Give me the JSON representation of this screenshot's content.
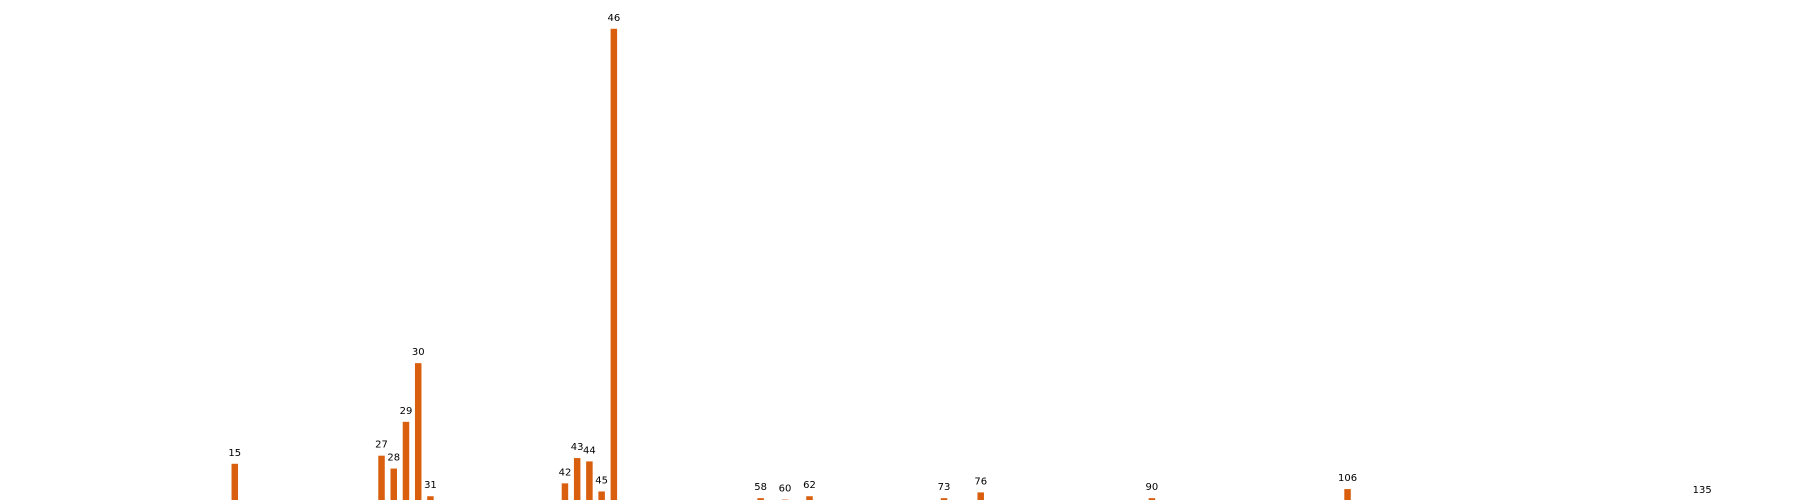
{
  "chart_data": {
    "type": "bar",
    "title": "",
    "xlabel": "",
    "ylabel": "",
    "grid": false,
    "legend": "none",
    "color": "#d95f0e",
    "show_axes": false,
    "xlim": [
      -4.2,
      143
    ],
    "ylim": [
      0,
      100
    ],
    "points": [
      {
        "x": 15,
        "y": 7.8
      },
      {
        "x": 27,
        "y": 9.5
      },
      {
        "x": 28,
        "y": 6.8
      },
      {
        "x": 29,
        "y": 16.6
      },
      {
        "x": 30,
        "y": 28.9
      },
      {
        "x": 31,
        "y": 1.0
      },
      {
        "x": 42,
        "y": 3.7
      },
      {
        "x": 43,
        "y": 9.0
      },
      {
        "x": 44,
        "y": 8.3
      },
      {
        "x": 45,
        "y": 2.0
      },
      {
        "x": 46,
        "y": 99.0
      },
      {
        "x": 58,
        "y": 0.6
      },
      {
        "x": 60,
        "y": 0.3
      },
      {
        "x": 62,
        "y": 1.0
      },
      {
        "x": 73,
        "y": 0.6
      },
      {
        "x": 76,
        "y": 1.8
      },
      {
        "x": 90,
        "y": 0.6
      },
      {
        "x": 106,
        "y": 2.5
      },
      {
        "x": 135,
        "y": 0
      }
    ]
  }
}
